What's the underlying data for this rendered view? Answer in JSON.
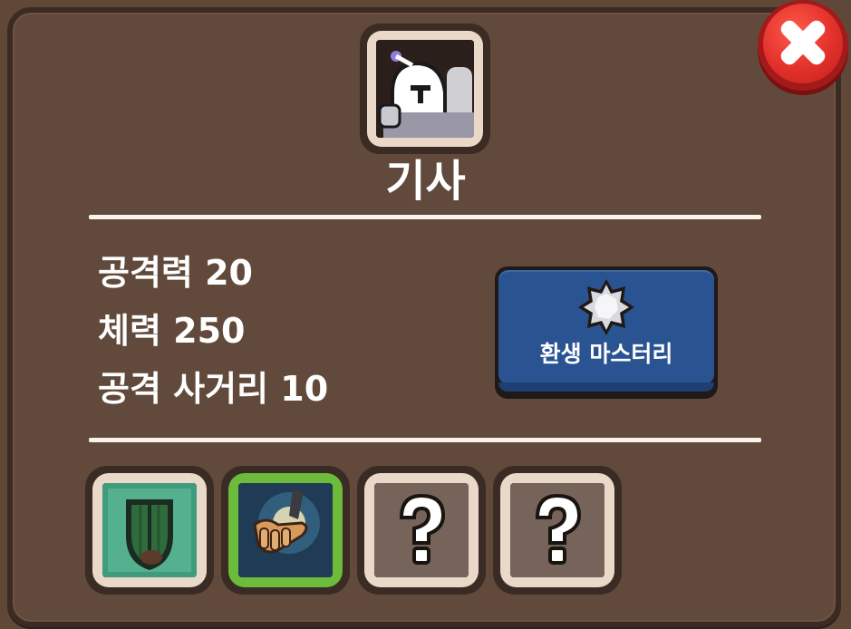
{
  "character": {
    "name": "기사",
    "portrait_icon": "knight-portrait-icon"
  },
  "close": {
    "icon": "close-icon",
    "color": "#e2302a"
  },
  "stats": [
    {
      "label": "공격력 20"
    },
    {
      "label": "체력 250"
    },
    {
      "label": "공격 사거리 10"
    }
  ],
  "mastery": {
    "label": "환생 마스터리",
    "icon": "silver-gem-icon",
    "color": "#2a5391"
  },
  "skills": [
    {
      "icon": "green-shield-icon",
      "state": "unlocked"
    },
    {
      "icon": "glowing-hand-icon",
      "state": "selected",
      "highlight": "#6dbb3a"
    },
    {
      "icon": "question-mark-icon",
      "state": "locked"
    },
    {
      "icon": "question-mark-icon",
      "state": "locked"
    }
  ]
}
